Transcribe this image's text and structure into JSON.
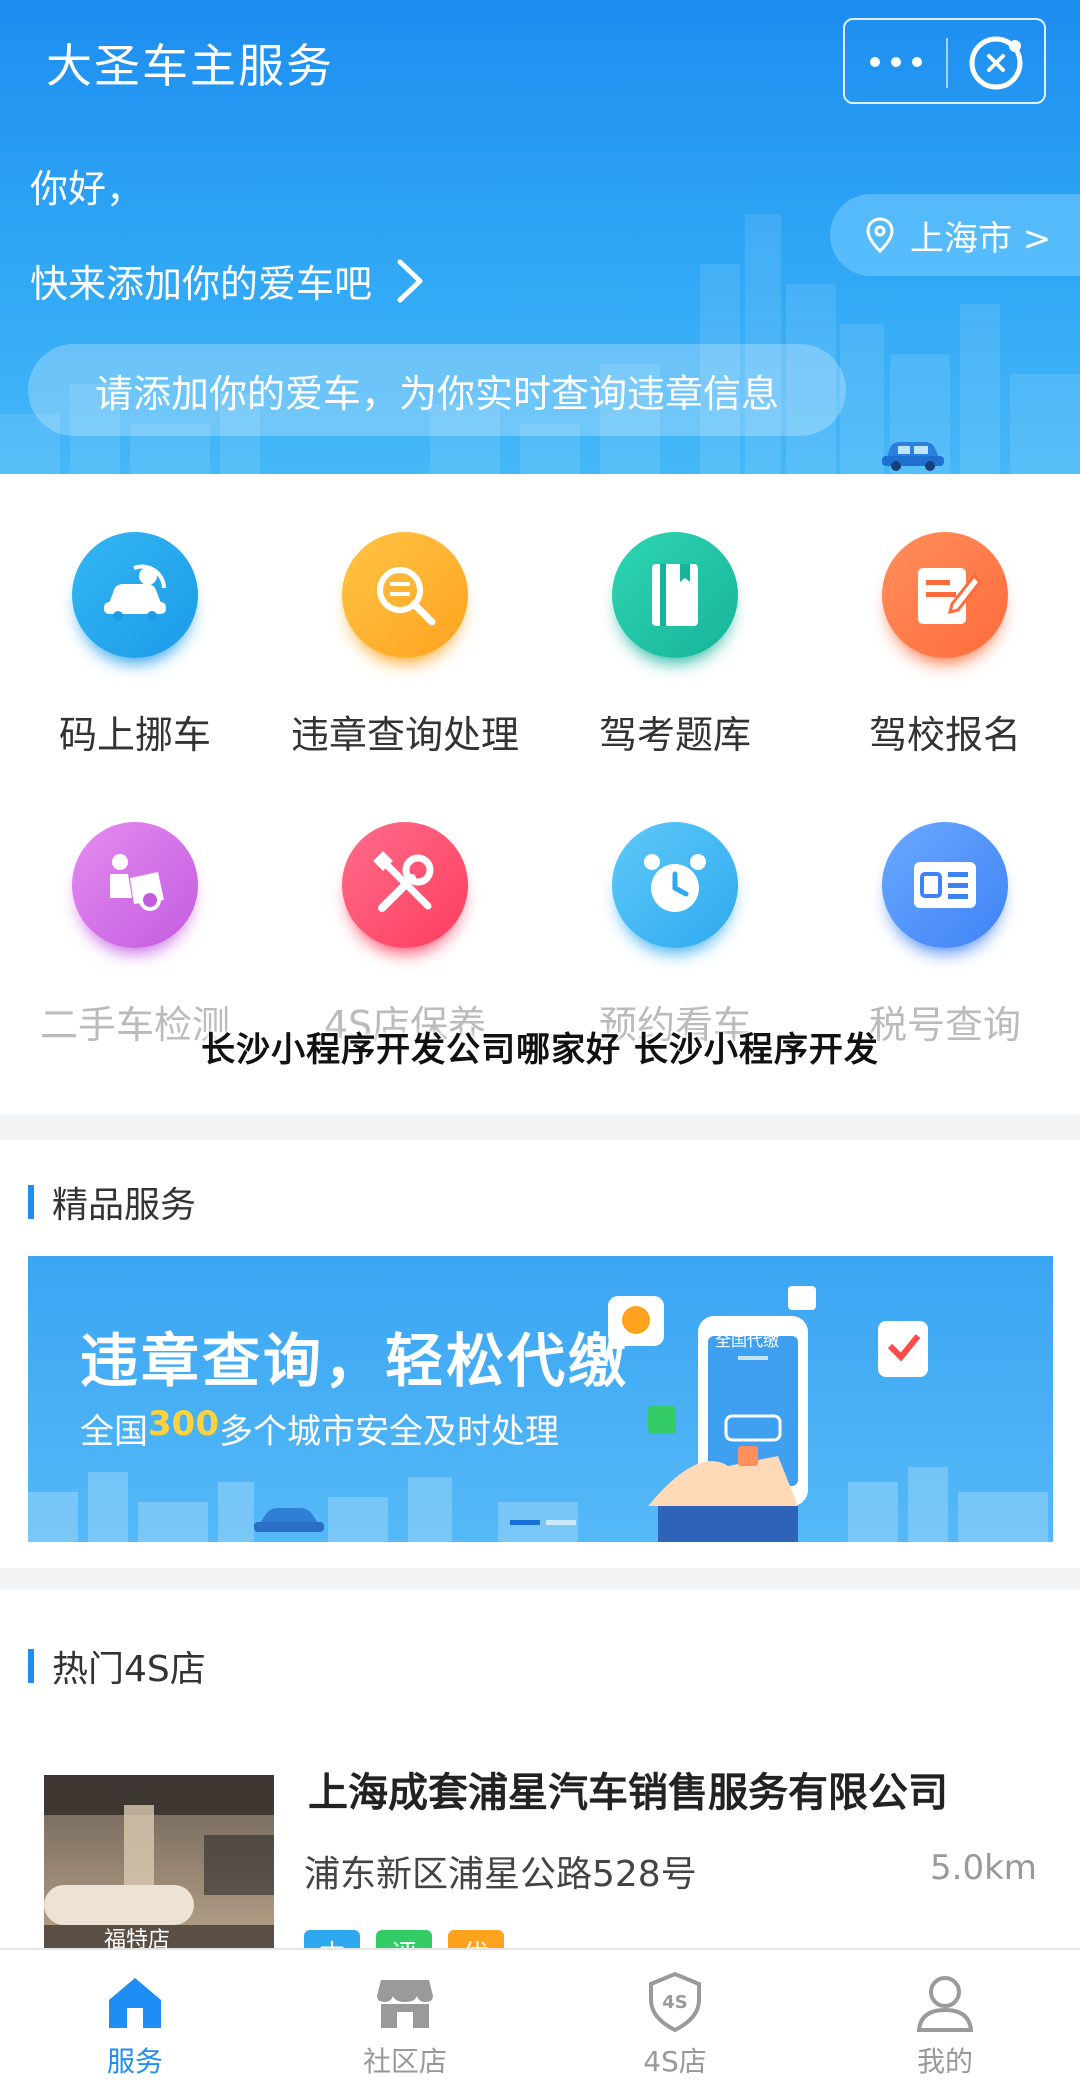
{
  "header": {
    "app_title": "大圣车主服务",
    "greeting": "你好，",
    "add_car_link": "快来添加你的爱车吧",
    "city": "上海市 >",
    "hint": "请添加你的爱车，为你实时查询违章信息"
  },
  "services": [
    {
      "label": "码上挪车",
      "icon": "car-move-icon",
      "color": "#35b6f2",
      "color2": "#1b9be8"
    },
    {
      "label": "违章查询处理",
      "icon": "violation-search-icon",
      "color": "#ffc445",
      "color2": "#ffa31f"
    },
    {
      "label": "驾考题库",
      "icon": "book-icon",
      "color": "#2ed6b2",
      "color2": "#17b39a"
    },
    {
      "label": "驾校报名",
      "icon": "signup-icon",
      "color": "#ff8f5c",
      "color2": "#ff6b3a"
    },
    {
      "label": "二手车检测",
      "icon": "used-car-check-icon",
      "color": "#e58cf0",
      "color2": "#c35be0"
    },
    {
      "label": "4S店保养",
      "icon": "wrench-icon",
      "color": "#ff6d8a",
      "color2": "#ff3d5f"
    },
    {
      "label": "预约看车",
      "icon": "alarm-clock-icon",
      "color": "#5fc9f8",
      "color2": "#2ea9ef"
    },
    {
      "label": "税号查询",
      "icon": "tax-icon",
      "color": "#6aa9ff",
      "color2": "#3f82f5"
    }
  ],
  "overlay_title": "长沙小程序开发公司哪家好 长沙小程序开发",
  "premium": {
    "section_title": "精品服务",
    "banner_title": "违章查询，轻松代缴",
    "banner_sub_pre": "全国",
    "banner_sub_num": "300",
    "banner_sub_post": "多个城市安全及时处理",
    "phone_text": "全国代缴"
  },
  "dealers": {
    "section_title": "热门4S店",
    "items": [
      {
        "name": "上海成套浦星汽车销售服务有限公司",
        "address": "浦东新区浦星公路528号",
        "distance": "5.0km",
        "photo_caption": "福特店",
        "tags": [
          {
            "text": "本",
            "color": "#2ea9ef"
          },
          {
            "text": "评",
            "color": "#33cc66"
          },
          {
            "text": "优",
            "color": "#ffa31f"
          }
        ]
      }
    ]
  },
  "tabbar": [
    {
      "label": "服务",
      "icon": "home-icon",
      "active": true
    },
    {
      "label": "社区店",
      "icon": "store-icon",
      "active": false
    },
    {
      "label": "4S店",
      "icon": "4s-badge-icon",
      "active": false
    },
    {
      "label": "我的",
      "icon": "profile-icon",
      "active": false
    }
  ],
  "colors": {
    "brand": "#1e8ef5",
    "header_top": "#1d8df0"
  }
}
